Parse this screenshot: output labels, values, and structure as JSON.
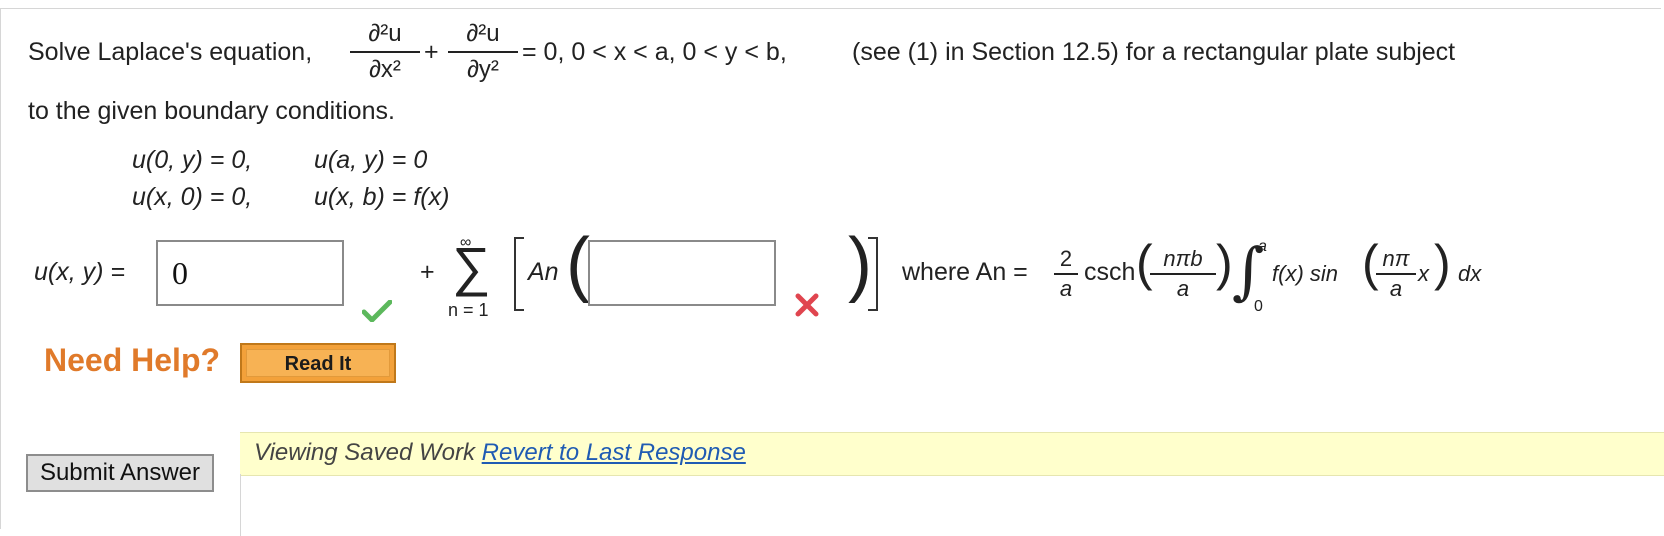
{
  "problem": {
    "intro": "Solve Laplace's equation,",
    "plus": "+",
    "d2u": "∂²u",
    "dx2": "∂x²",
    "dy2": "∂y²",
    "condition": "= 0, 0 < x < a, 0 < y < b,",
    "reference": "(see (1) in Section 12.5) for a rectangular plate subject",
    "line2": "to the given boundary conditions."
  },
  "boundary": {
    "row1_left": "u(0, y) = 0,",
    "row1_right": "u(a, y) = 0",
    "row2_left": "u(x, 0) = 0,",
    "row2_right": "u(x, b) = f(x)"
  },
  "answer": {
    "lhs": "u(x, y) =",
    "box1_value": "0",
    "box1_status": "correct",
    "plus": "+",
    "sum_top": "∞",
    "sum_sigma": "∑",
    "sum_bottom": "n = 1",
    "coef": "An",
    "box2_value": "",
    "box2_status": "incorrect",
    "where": "where An =",
    "frac2_num": "2",
    "frac2_den": "a",
    "csch": "csch",
    "arg_num": "nπb",
    "arg_den": "a",
    "int_upper": "a",
    "int_lower": "0",
    "integrand": "f(x) sin",
    "sin_num": "nπ",
    "sin_den": "a",
    "sin_x": "x",
    "dx": "dx"
  },
  "help": {
    "label": "Need Help?",
    "read_it": "Read It"
  },
  "saved": {
    "text": "Viewing Saved Work",
    "link": "Revert to Last Response"
  },
  "submit": "Submit Answer",
  "colors": {
    "check": "#5cb85c",
    "cross": "#e0454f",
    "help": "#e07a2a",
    "button": "#f3a13a",
    "saved_bg": "#ffffcc",
    "link": "#1f5bb3"
  },
  "icons": [
    "check-icon",
    "cross-icon",
    "sigma-symbol",
    "integral-symbol"
  ]
}
